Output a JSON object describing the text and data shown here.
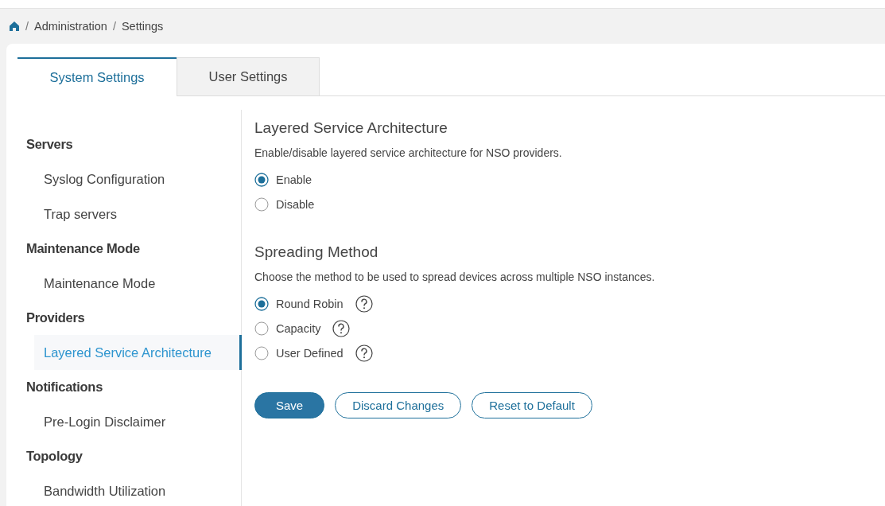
{
  "breadcrumb": [
    {
      "kind": "separator",
      "text": "/"
    },
    {
      "kind": "link",
      "text": "Administration"
    },
    {
      "kind": "separator",
      "text": "/"
    },
    {
      "kind": "link",
      "text": "Settings"
    }
  ],
  "tabs": [
    {
      "label": "System Settings",
      "selected": true
    },
    {
      "label": "User Settings",
      "selected": false
    }
  ],
  "sidebar": {
    "sections": [
      {
        "heading": "Servers",
        "items": [
          {
            "label": "Syslog Configuration",
            "selected": false
          },
          {
            "label": "Trap servers",
            "selected": false
          }
        ]
      },
      {
        "heading": "Maintenance Mode",
        "items": [
          {
            "label": "Maintenance Mode",
            "selected": false
          }
        ]
      },
      {
        "heading": "Providers",
        "items": [
          {
            "label": "Layered Service Architecture",
            "selected": true
          }
        ]
      },
      {
        "heading": "Notifications",
        "items": [
          {
            "label": "Pre-Login Disclaimer",
            "selected": false
          }
        ]
      },
      {
        "heading": "Topology",
        "items": [
          {
            "label": "Bandwidth Utilization",
            "selected": false
          }
        ]
      }
    ]
  },
  "content": {
    "groups": [
      {
        "title": "Layered Service Architecture",
        "description": "Enable/disable layered service architecture for NSO providers.",
        "options": [
          {
            "label": "Enable",
            "selected": true,
            "help": false
          },
          {
            "label": "Disable",
            "selected": false,
            "help": false
          }
        ]
      },
      {
        "title": "Spreading Method",
        "description": "Choose the method to be used to spread devices across multiple NSO instances.",
        "options": [
          {
            "label": "Round Robin",
            "selected": true,
            "help": true
          },
          {
            "label": "Capacity",
            "selected": false,
            "help": true
          },
          {
            "label": "User Defined",
            "selected": false,
            "help": true
          }
        ]
      }
    ],
    "buttons": [
      {
        "label": "Save",
        "kind": "primary"
      },
      {
        "label": "Discard Changes",
        "kind": "outline"
      },
      {
        "label": "Reset to Default",
        "kind": "outline"
      }
    ]
  }
}
